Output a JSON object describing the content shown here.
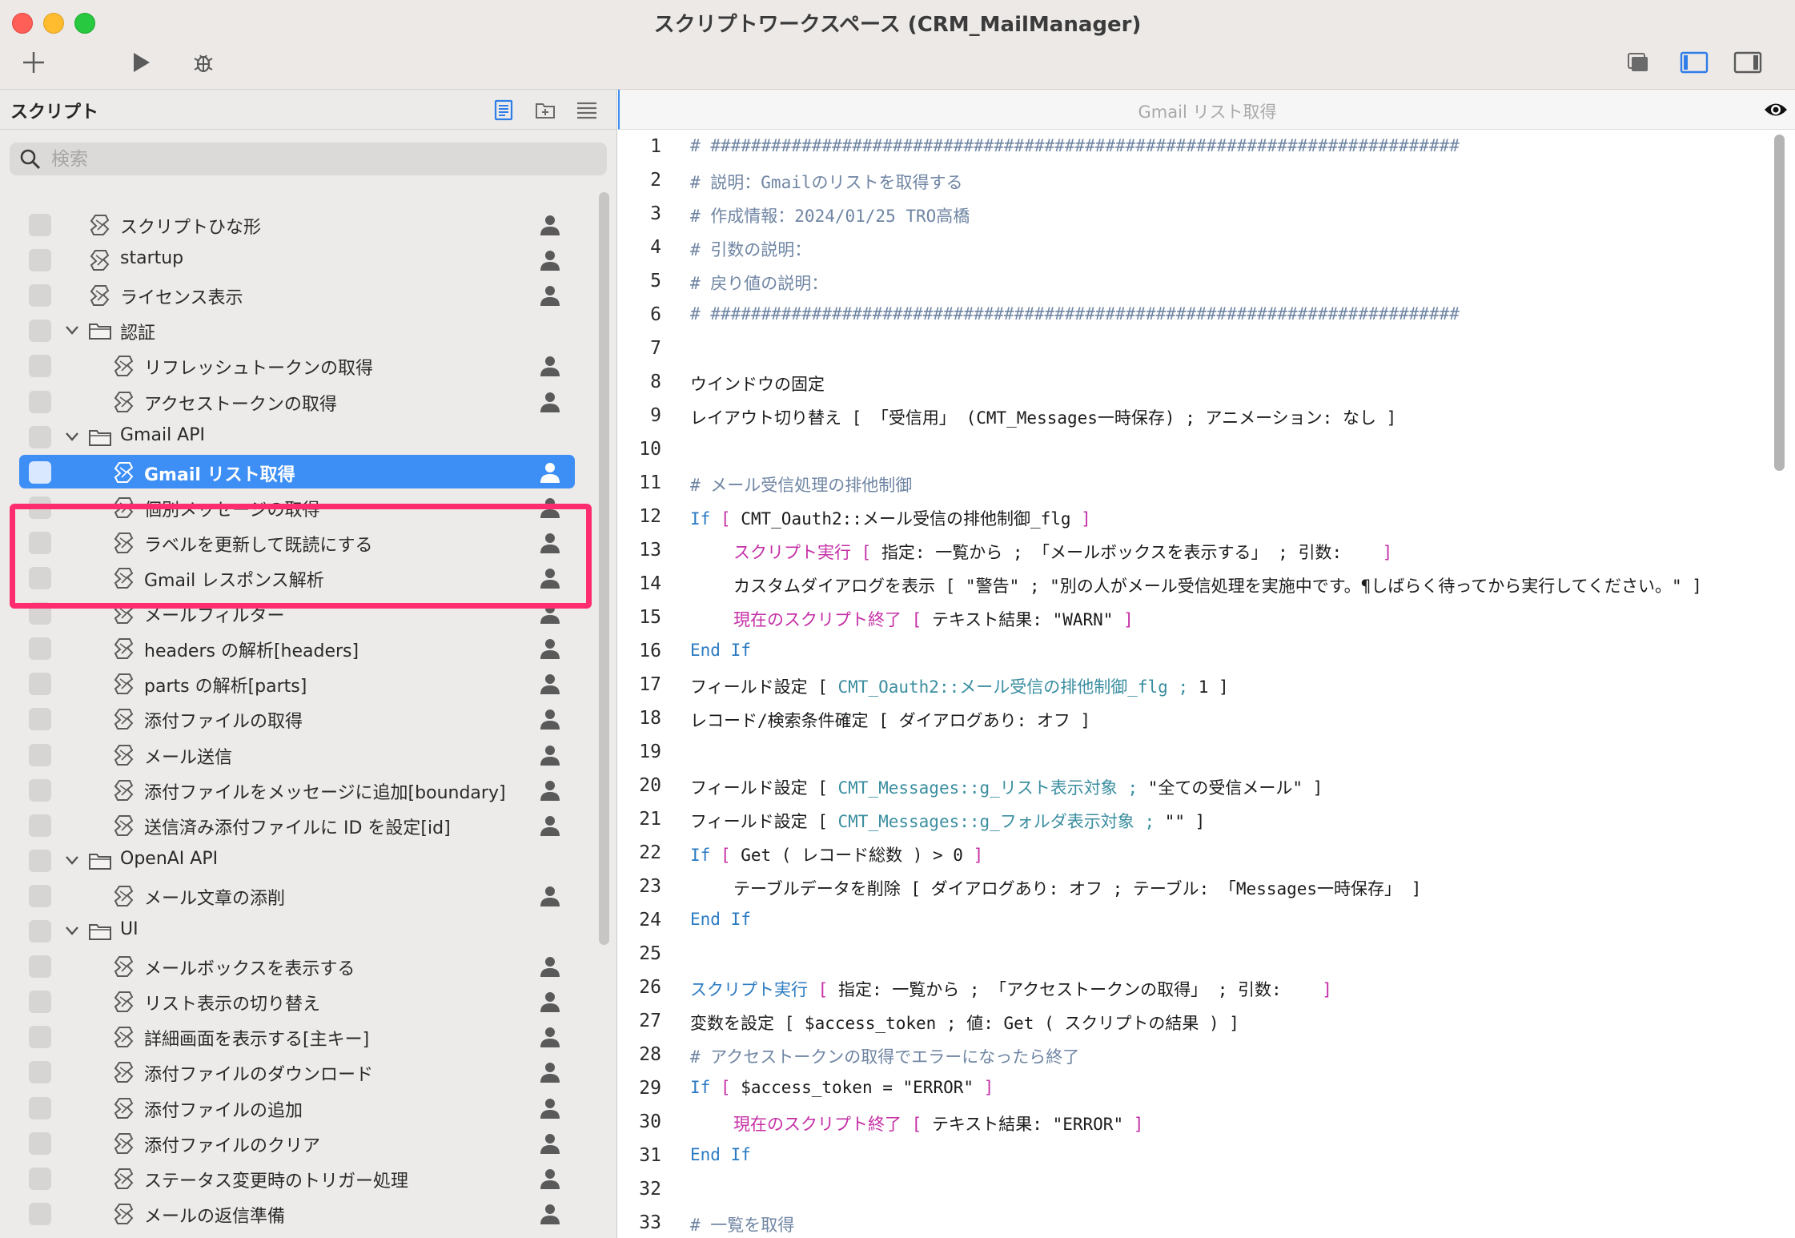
{
  "window": {
    "title": "スクリプトワークスペース (CRM_MailManager)"
  },
  "toolbar": {
    "add_icon": "plus-icon",
    "run_icon": "play-icon",
    "debug_icon": "bug-icon",
    "right_icons": [
      "windows-icon",
      "sidebar-left-icon",
      "sidebar-right-icon"
    ]
  },
  "sidebar": {
    "title": "スクリプト",
    "search_placeholder": "検索",
    "items": [
      {
        "label": "スクリプトひな形",
        "type": "script",
        "level": 0
      },
      {
        "label": "startup",
        "type": "script",
        "level": 0
      },
      {
        "label": "ライセンス表示",
        "type": "script",
        "level": 0
      },
      {
        "label": "認証",
        "type": "folder",
        "level": 0
      },
      {
        "label": "リフレッシュトークンの取得",
        "type": "script",
        "level": 1
      },
      {
        "label": "アクセストークンの取得",
        "type": "script",
        "level": 1
      },
      {
        "label": "Gmail API",
        "type": "folder",
        "level": 0
      },
      {
        "label": "Gmail リスト取得",
        "type": "script",
        "level": 1,
        "selected": true
      },
      {
        "label": "個別メッセージの取得",
        "type": "script",
        "level": 1
      },
      {
        "label": "ラベルを更新して既読にする",
        "type": "script",
        "level": 1
      },
      {
        "label": "Gmail レスポンス解析",
        "type": "script",
        "level": 1
      },
      {
        "label": "メールフィルター",
        "type": "script",
        "level": 1
      },
      {
        "label": "headers の解析[headers]",
        "type": "script",
        "level": 1
      },
      {
        "label": "parts の解析[parts]",
        "type": "script",
        "level": 1
      },
      {
        "label": "添付ファイルの取得",
        "type": "script",
        "level": 1
      },
      {
        "label": "メール送信",
        "type": "script",
        "level": 1
      },
      {
        "label": "添付ファイルをメッセージに追加[boundary]",
        "type": "script",
        "level": 1
      },
      {
        "label": "送信済み添付ファイルに ID を設定[id]",
        "type": "script",
        "level": 1
      },
      {
        "label": "OpenAI API",
        "type": "folder",
        "level": 0
      },
      {
        "label": "メール文章の添削",
        "type": "script",
        "level": 1
      },
      {
        "label": "UI",
        "type": "folder",
        "level": 0
      },
      {
        "label": "メールボックスを表示する",
        "type": "script",
        "level": 1
      },
      {
        "label": "リスト表示の切り替え",
        "type": "script",
        "level": 1
      },
      {
        "label": "詳細画面を表示する[主キー]",
        "type": "script",
        "level": 1
      },
      {
        "label": "添付ファイルのダウンロード",
        "type": "script",
        "level": 1
      },
      {
        "label": "添付ファイルの追加",
        "type": "script",
        "level": 1
      },
      {
        "label": "添付ファイルのクリア",
        "type": "script",
        "level": 1
      },
      {
        "label": "ステータス変更時のトリガー処理",
        "type": "script",
        "level": 1
      },
      {
        "label": "メールの返信準備",
        "type": "script",
        "level": 1
      }
    ]
  },
  "editor": {
    "title": "Gmail リスト取得",
    "lines": [
      {
        "n": "1",
        "indent": 0,
        "seg": [
          [
            "c",
            "# ##########################################################################"
          ]
        ]
      },
      {
        "n": "2",
        "indent": 0,
        "seg": [
          [
            "c",
            "# 説明：Gmailのリストを取得する"
          ]
        ]
      },
      {
        "n": "3",
        "indent": 0,
        "seg": [
          [
            "c",
            "# 作成情報：2024/01/25 TRO高橋"
          ]
        ]
      },
      {
        "n": "4",
        "indent": 0,
        "seg": [
          [
            "c",
            "# 引数の説明："
          ]
        ]
      },
      {
        "n": "5",
        "indent": 0,
        "seg": [
          [
            "c",
            "# 戻り値の説明："
          ]
        ]
      },
      {
        "n": "6",
        "indent": 0,
        "seg": [
          [
            "c",
            "# ##########################################################################"
          ]
        ]
      },
      {
        "n": "7",
        "indent": 0,
        "seg": []
      },
      {
        "n": "8",
        "indent": 0,
        "seg": [
          [
            "t",
            "ウインドウの固定"
          ]
        ]
      },
      {
        "n": "9",
        "indent": 0,
        "seg": [
          [
            "t",
            "レイアウト切り替え [ 「受信用」 (CMT_Messages一時保存) ; アニメーション: なし ]"
          ]
        ]
      },
      {
        "n": "10",
        "indent": 0,
        "seg": []
      },
      {
        "n": "11",
        "indent": 0,
        "seg": [
          [
            "c",
            "# メール受信処理の排他制御"
          ]
        ]
      },
      {
        "n": "12",
        "indent": 0,
        "seg": [
          [
            "k",
            "If "
          ],
          [
            "m",
            "[ "
          ],
          [
            "t",
            "CMT_Oauth2::メール受信の排他制御_flg "
          ],
          [
            "m",
            "]"
          ]
        ]
      },
      {
        "n": "13",
        "indent": 1,
        "seg": [
          [
            "m",
            "スクリプト実行 [ "
          ],
          [
            "t",
            "指定: 一覧から ; 「メールボックスを表示する」 ; 引数:    "
          ],
          [
            "m",
            "]"
          ]
        ]
      },
      {
        "n": "14",
        "indent": 1,
        "seg": [
          [
            "t",
            "カスタムダイアログを表示 [ \"警告\" ; \"別の人がメール受信処理を実施中です。¶しばらく待ってから実行してください。\" ]"
          ]
        ]
      },
      {
        "n": "15",
        "indent": 1,
        "seg": [
          [
            "m",
            "現在のスクリプト終了 [ "
          ],
          [
            "t",
            "テキスト結果: \"WARN\" "
          ],
          [
            "m",
            "]"
          ]
        ]
      },
      {
        "n": "16",
        "indent": 0,
        "seg": [
          [
            "k",
            "End If"
          ]
        ]
      },
      {
        "n": "17",
        "indent": 0,
        "seg": [
          [
            "t",
            "フィールド設定 [ "
          ],
          [
            "f",
            "CMT_Oauth2::メール受信の排他制御_flg ; "
          ],
          [
            "t",
            "1 ]"
          ]
        ]
      },
      {
        "n": "18",
        "indent": 0,
        "seg": [
          [
            "t",
            "レコード/検索条件確定 [ ダイアログあり: オフ ]"
          ]
        ]
      },
      {
        "n": "19",
        "indent": 0,
        "seg": []
      },
      {
        "n": "20",
        "indent": 0,
        "seg": [
          [
            "t",
            "フィールド設定 [ "
          ],
          [
            "f",
            "CMT_Messages::g_リスト表示対象 ; "
          ],
          [
            "t",
            "\"全ての受信メール\" ]"
          ]
        ]
      },
      {
        "n": "21",
        "indent": 0,
        "seg": [
          [
            "t",
            "フィールド設定 [ "
          ],
          [
            "f",
            "CMT_Messages::g_フォルダ表示対象 ; "
          ],
          [
            "t",
            "\"\" ]"
          ]
        ]
      },
      {
        "n": "22",
        "indent": 0,
        "seg": [
          [
            "k",
            "If "
          ],
          [
            "m",
            "[ "
          ],
          [
            "t",
            "Get ( レコード総数 ) > 0 "
          ],
          [
            "m",
            "]"
          ]
        ]
      },
      {
        "n": "23",
        "indent": 1,
        "seg": [
          [
            "t",
            "テーブルデータを削除 [ ダイアログあり: オフ ; テーブル: 「Messages一時保存」 ]"
          ]
        ]
      },
      {
        "n": "24",
        "indent": 0,
        "seg": [
          [
            "k",
            "End If"
          ]
        ]
      },
      {
        "n": "25",
        "indent": 0,
        "seg": []
      },
      {
        "n": "26",
        "indent": 0,
        "seg": [
          [
            "k",
            "スクリプト実行 "
          ],
          [
            "m",
            "[ "
          ],
          [
            "t",
            "指定: 一覧から ; 「アクセストークンの取得」 ; 引数:    "
          ],
          [
            "m",
            "]"
          ]
        ]
      },
      {
        "n": "27",
        "indent": 0,
        "seg": [
          [
            "t",
            "変数を設定 [ $access_token ; 値: Get ( スクリプトの結果 ) ]"
          ]
        ]
      },
      {
        "n": "28",
        "indent": 0,
        "seg": [
          [
            "c",
            "# アクセストークンの取得でエラーになったら終了"
          ]
        ]
      },
      {
        "n": "29",
        "indent": 0,
        "seg": [
          [
            "k",
            "If "
          ],
          [
            "m",
            "[ "
          ],
          [
            "t",
            "$access_token = \"ERROR\" "
          ],
          [
            "m",
            "]"
          ]
        ]
      },
      {
        "n": "30",
        "indent": 1,
        "seg": [
          [
            "m",
            "現在のスクリプト終了 [ "
          ],
          [
            "t",
            "テキスト結果: \"ERROR\" "
          ],
          [
            "m",
            "]"
          ]
        ]
      },
      {
        "n": "31",
        "indent": 0,
        "seg": [
          [
            "k",
            "End If"
          ]
        ]
      },
      {
        "n": "32",
        "indent": 0,
        "seg": []
      },
      {
        "n": "33",
        "indent": 0,
        "seg": [
          [
            "c",
            "# 一覧を取得"
          ]
        ]
      }
    ]
  },
  "colors": {
    "accent": "#3d8ff5",
    "highlight": "#ff2d6f",
    "comment": "#6f85a3",
    "keyword": "#2a7ac2",
    "step": "#c52fa6",
    "field": "#3b8ea0"
  }
}
